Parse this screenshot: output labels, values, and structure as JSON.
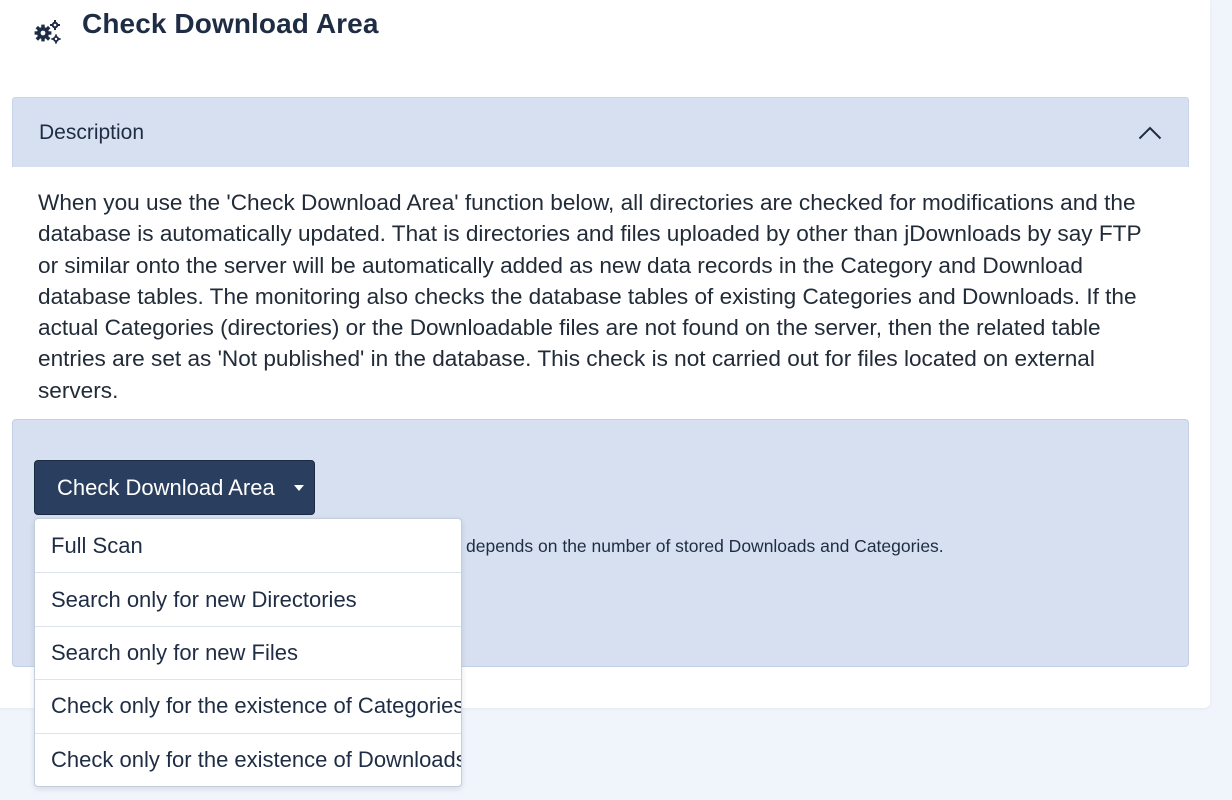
{
  "header": {
    "title": "Check Download Area",
    "icon": "gears-icon"
  },
  "description": {
    "title": "Description",
    "toggle_icon": "chevron-up-icon",
    "text": "When you use the 'Check Download Area' function below, all directories are checked for modifications and the database is automatically updated. That is directories and files uploaded by other than jDownloads by say FTP or similar onto the server will be automatically added as new data records in the Category and Download database tables. The monitoring also checks the database tables of existing Categories and Downloads. If the actual Categories (directories) or the Downloadable files are not found on the server, then the related table entries are set as 'Not published' in the database. This check is not carried out for files located on external servers."
  },
  "action": {
    "button_label": "Check Download Area",
    "caret_icon": "caret-down-icon",
    "hint_text": "depends on the number of stored Downloads and Categories."
  },
  "dropdown": {
    "items": [
      "Full Scan",
      "Search only for new Directories",
      "Search only for new Files",
      "Check only for the existence of Categories",
      "Check only for the existence of Downloads"
    ]
  },
  "colors": {
    "accent_header": "#d6e0f0",
    "button_bg": "#2a3f5f",
    "text": "#1f2d44"
  }
}
